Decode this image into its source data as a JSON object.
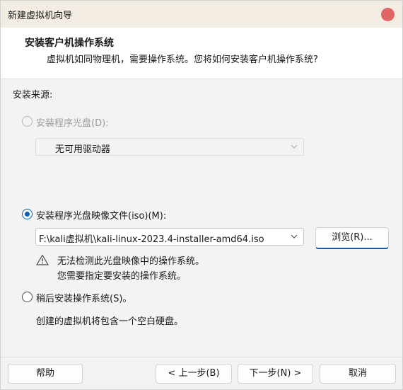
{
  "window": {
    "title": "新建虚拟机向导"
  },
  "header": {
    "title": "安装客户机操作系统",
    "subtitle": "虚拟机如同物理机，需要操作系统。您将如何安装客户机操作系统?"
  },
  "install_source": {
    "label": "安装来源:",
    "options": {
      "disc": {
        "label": "安装程序光盘(D):",
        "selected": false,
        "enabled": false,
        "drive_value": "无可用驱动器"
      },
      "iso": {
        "label": "安装程序光盘映像文件(iso)(M):",
        "selected": true,
        "path_value": "F:\\kali虚拟机\\kali-linux-2023.4-installer-amd64.iso",
        "browse_label": "浏览(R)...",
        "warning_line1": "无法检测此光盘映像中的操作系统。",
        "warning_line2": "您需要指定要安装的操作系统。"
      },
      "later": {
        "label": "稍后安装操作系统(S)。",
        "selected": false,
        "description": "创建的虚拟机将包含一个空白硬盘。"
      }
    }
  },
  "footer": {
    "help_label": "帮助",
    "back_label": "< 上一步(B)",
    "next_label": "下一步(N) >",
    "cancel_label": "取消"
  },
  "colors": {
    "accent": "#0a5fb8",
    "close_button": "#e06666",
    "titlebar": "#f3ece2"
  }
}
